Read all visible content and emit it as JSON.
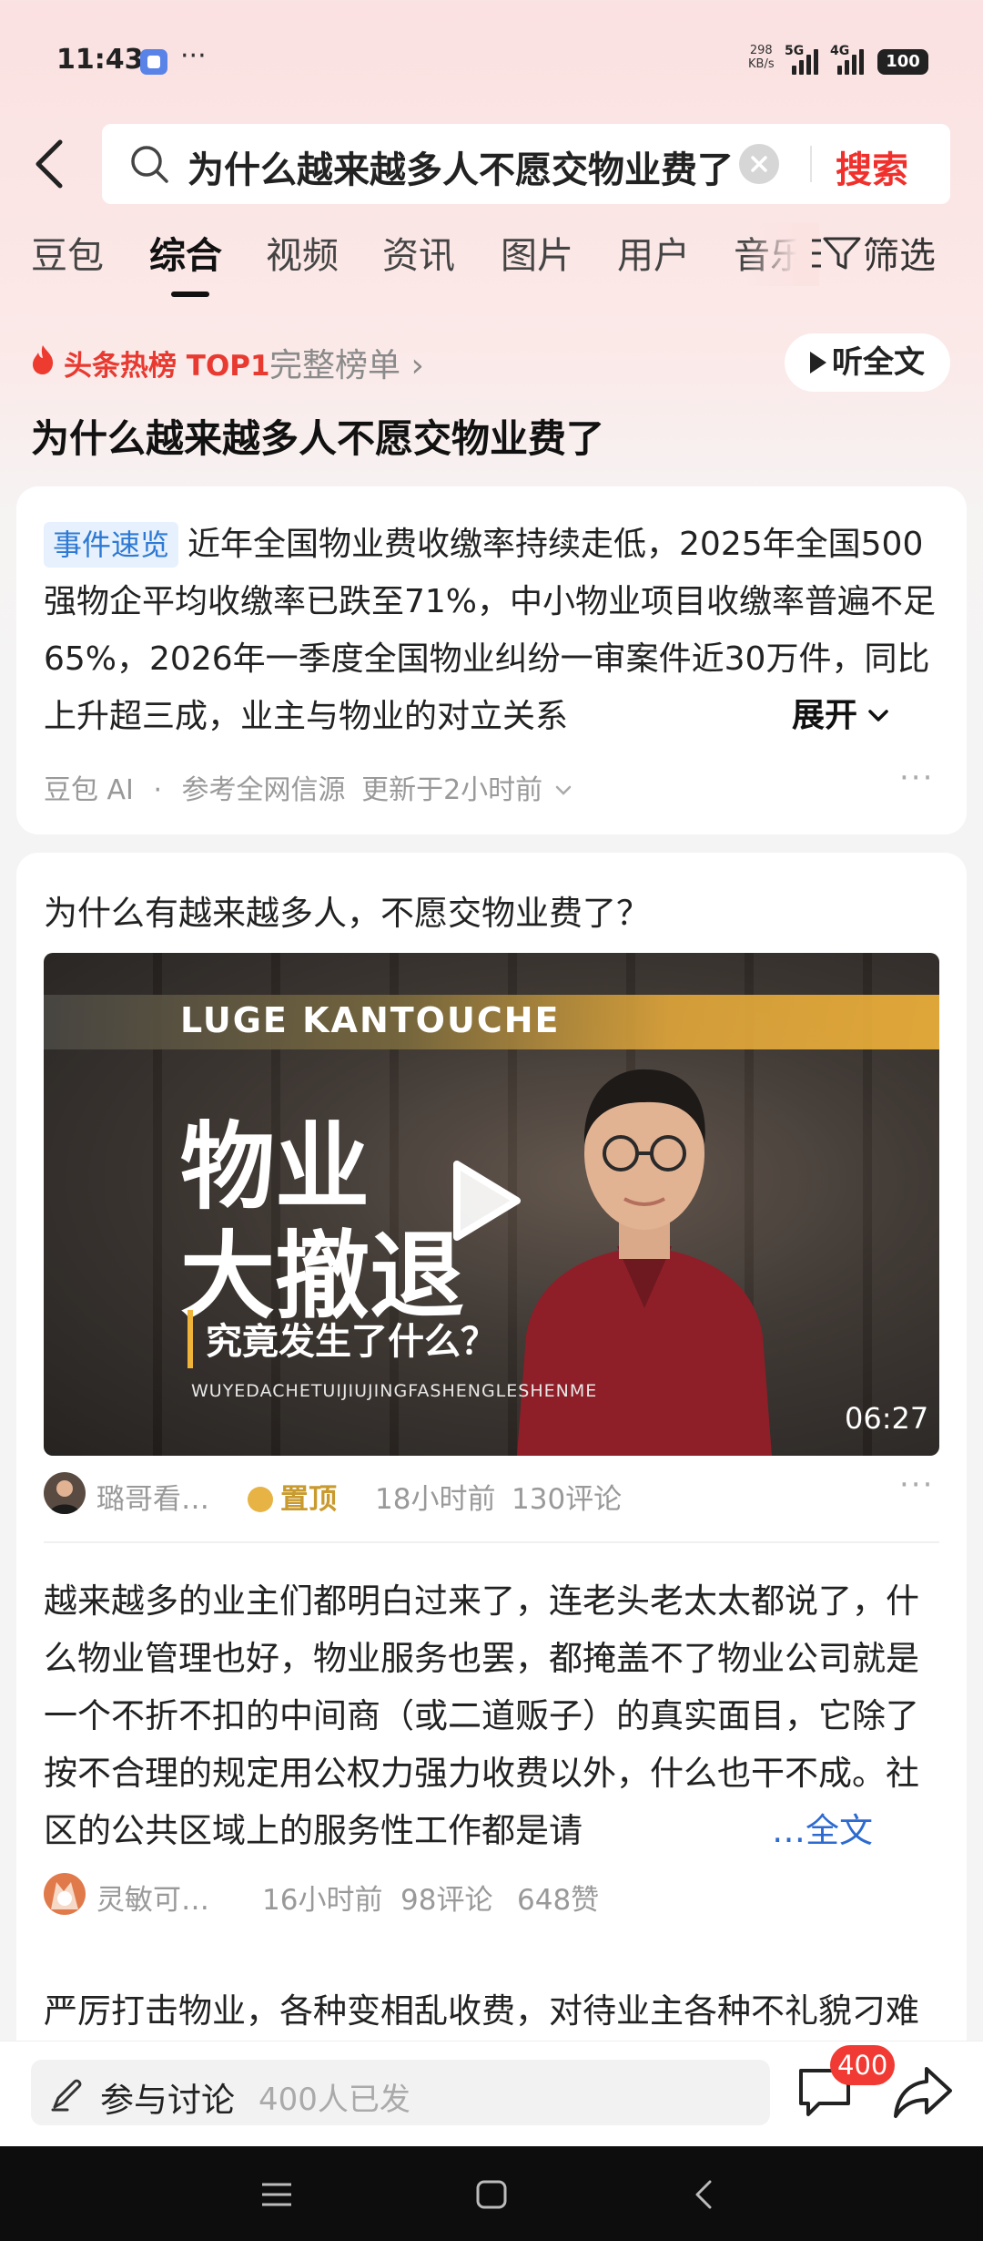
{
  "status_bar": {
    "time": "11:43",
    "more": "···",
    "speed_value": "298",
    "speed_unit": "KB/s",
    "net1": "5G",
    "net2": "4G",
    "battery": "100"
  },
  "search": {
    "query": "为什么越来越多人不愿交物业费了",
    "submit_label": "搜索"
  },
  "tabs": [
    "豆包",
    "综合",
    "视频",
    "资讯",
    "图片",
    "用户",
    "音乐"
  ],
  "active_tab": "综合",
  "filter_label": "筛选",
  "hot": {
    "label": "头条热榜 TOP1",
    "board_link": "完整榜单 ›",
    "listen_label": "听全文"
  },
  "page_title": "为什么越来越多人不愿交物业费了",
  "summary": {
    "tag": "事件速览",
    "text": "近年全国物业费收缴率持续走低，2025年全国500强物企平均收缴率已跌至71%，中小物业项目收缴率普遍不足65%，2026年一季度全国物业纠纷一审案件近30万件，同比上升超三成，业主与物业的对立关系",
    "expand_label": "展开",
    "source": "豆包 AI",
    "dot": "·",
    "ref": "参考全网信源",
    "updated": "更新于2小时前"
  },
  "video_post": {
    "question": "为什么有越来越多人，不愿交物业费了？",
    "video": {
      "brand": "LUGE KANTOUCHE",
      "headline_1": "物业",
      "headline_2": "大撤退",
      "subtitle": "究竟发生了什么？",
      "pinyin": "WUYEDACHETUIJIUJINGFASHENGLESHENME",
      "duration": "06:27"
    },
    "author": "璐哥看…",
    "pin_label": "置顶",
    "time": "18小时前",
    "comments": "130评论"
  },
  "answer_1": {
    "text": "越来越多的业主们都明白过来了，连老头老太太都说了，什么物业管理也好，物业服务也罢，都掩盖不了物业公司就是一个不折不扣的中间商（或二道贩子）的真实面目，它除了按不合理的规定用公权力强力收费以外，什么也干不成。社区的公共区域上的服务性工作都是请",
    "expand_label": "…全文",
    "author": "灵敏可…",
    "time": "16小时前",
    "comments": "98评论",
    "likes": "648赞"
  },
  "answer_2": {
    "text": "严厉打击物业，各种变相乱收费，对待业主各种不礼貌刁难"
  },
  "bottom_bar": {
    "discuss_label": "参与讨论",
    "discuss_count": "400人已发",
    "comment_badge": "400"
  },
  "colors": {
    "accent_red": "#f0302c",
    "link_blue": "#2d6ad0",
    "tag_blue": "#2d79d4",
    "gold": "#c99a2e"
  }
}
